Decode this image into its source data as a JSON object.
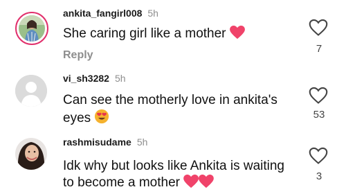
{
  "comments": [
    {
      "username": "ankita_fangirl008",
      "time": "5h",
      "text": "She caring girl like a mother",
      "emoji": "heart",
      "reply_label": "Reply",
      "likes": "7"
    },
    {
      "username": "vi_sh3282",
      "time": "5h",
      "text_line1": "Can see the motherly love in ankita's",
      "text_line2": "eyes",
      "emoji": "heart-eyes-face",
      "likes": "53"
    },
    {
      "username": "rashmisudame",
      "time": "5h",
      "text_line1": "Idk why but looks like Ankita is waiting",
      "text_line2": "to become a mother",
      "emoji": "two-hearts",
      "likes": "3"
    }
  ],
  "colors": {
    "story_ring": "#e1306c",
    "heart_emoji": "#f0436a",
    "muted": "#8e8e8e"
  }
}
